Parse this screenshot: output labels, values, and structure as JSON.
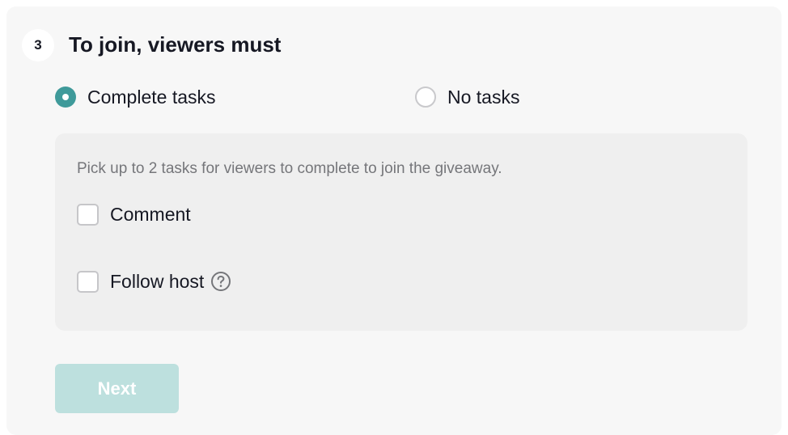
{
  "step": {
    "number": "3",
    "title": "To join, viewers must"
  },
  "options": [
    {
      "label": "Complete tasks",
      "selected": true
    },
    {
      "label": "No tasks",
      "selected": false
    }
  ],
  "tasks": {
    "hint": "Pick up to 2 tasks for viewers to complete to join the giveaway.",
    "items": [
      {
        "label": "Comment",
        "checked": false
      },
      {
        "label": "Follow host",
        "checked": false,
        "icon": "help-icon"
      }
    ]
  },
  "actions": {
    "next_label": "Next",
    "next_disabled": true
  },
  "colors": {
    "accent": "#3f9a9a",
    "button_disabled": "#bde0de",
    "card_bg": "#f7f7f7",
    "tasks_bg": "#efefef"
  }
}
